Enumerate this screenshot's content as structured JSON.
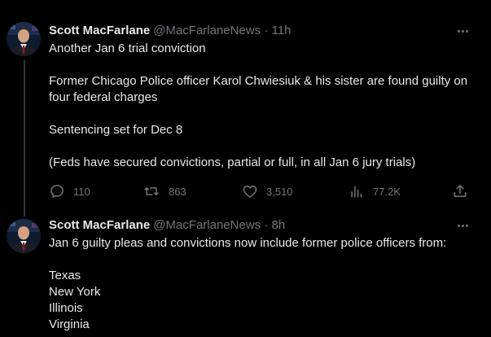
{
  "colors": {
    "background": "#000000",
    "text_primary": "#e7e9ea",
    "text_secondary": "#71767b",
    "thread_line": "#333639"
  },
  "icons": {
    "reply": "reply-icon",
    "retweet": "retweet-icon",
    "like": "heart-icon",
    "views": "views-chart-icon",
    "share": "share-icon",
    "more": "more-options-icon"
  },
  "tweets": [
    {
      "author_name": "Scott MacFarlane",
      "handle": "@MacFarlaneNews",
      "separator": "·",
      "timestamp": "11h",
      "paragraphs": [
        "Another Jan 6 trial conviction",
        "Former Chicago Police officer Karol Chwiesiuk & his sister are found guilty on four federal charges",
        "Sentencing set for Dec 8",
        "(Feds have secured convictions, partial or full, in all Jan 6 jury trials)"
      ],
      "stats": {
        "replies": "110",
        "retweets": "863",
        "likes": "3,510",
        "views": "77.2K"
      }
    },
    {
      "author_name": "Scott MacFarlane",
      "handle": "@MacFarlaneNews",
      "separator": "·",
      "timestamp": "8h",
      "intro": "Jan 6 guilty pleas and convictions now include former police officers from:",
      "states": [
        "Texas",
        "New York",
        "Illinois",
        "Virginia"
      ]
    }
  ]
}
